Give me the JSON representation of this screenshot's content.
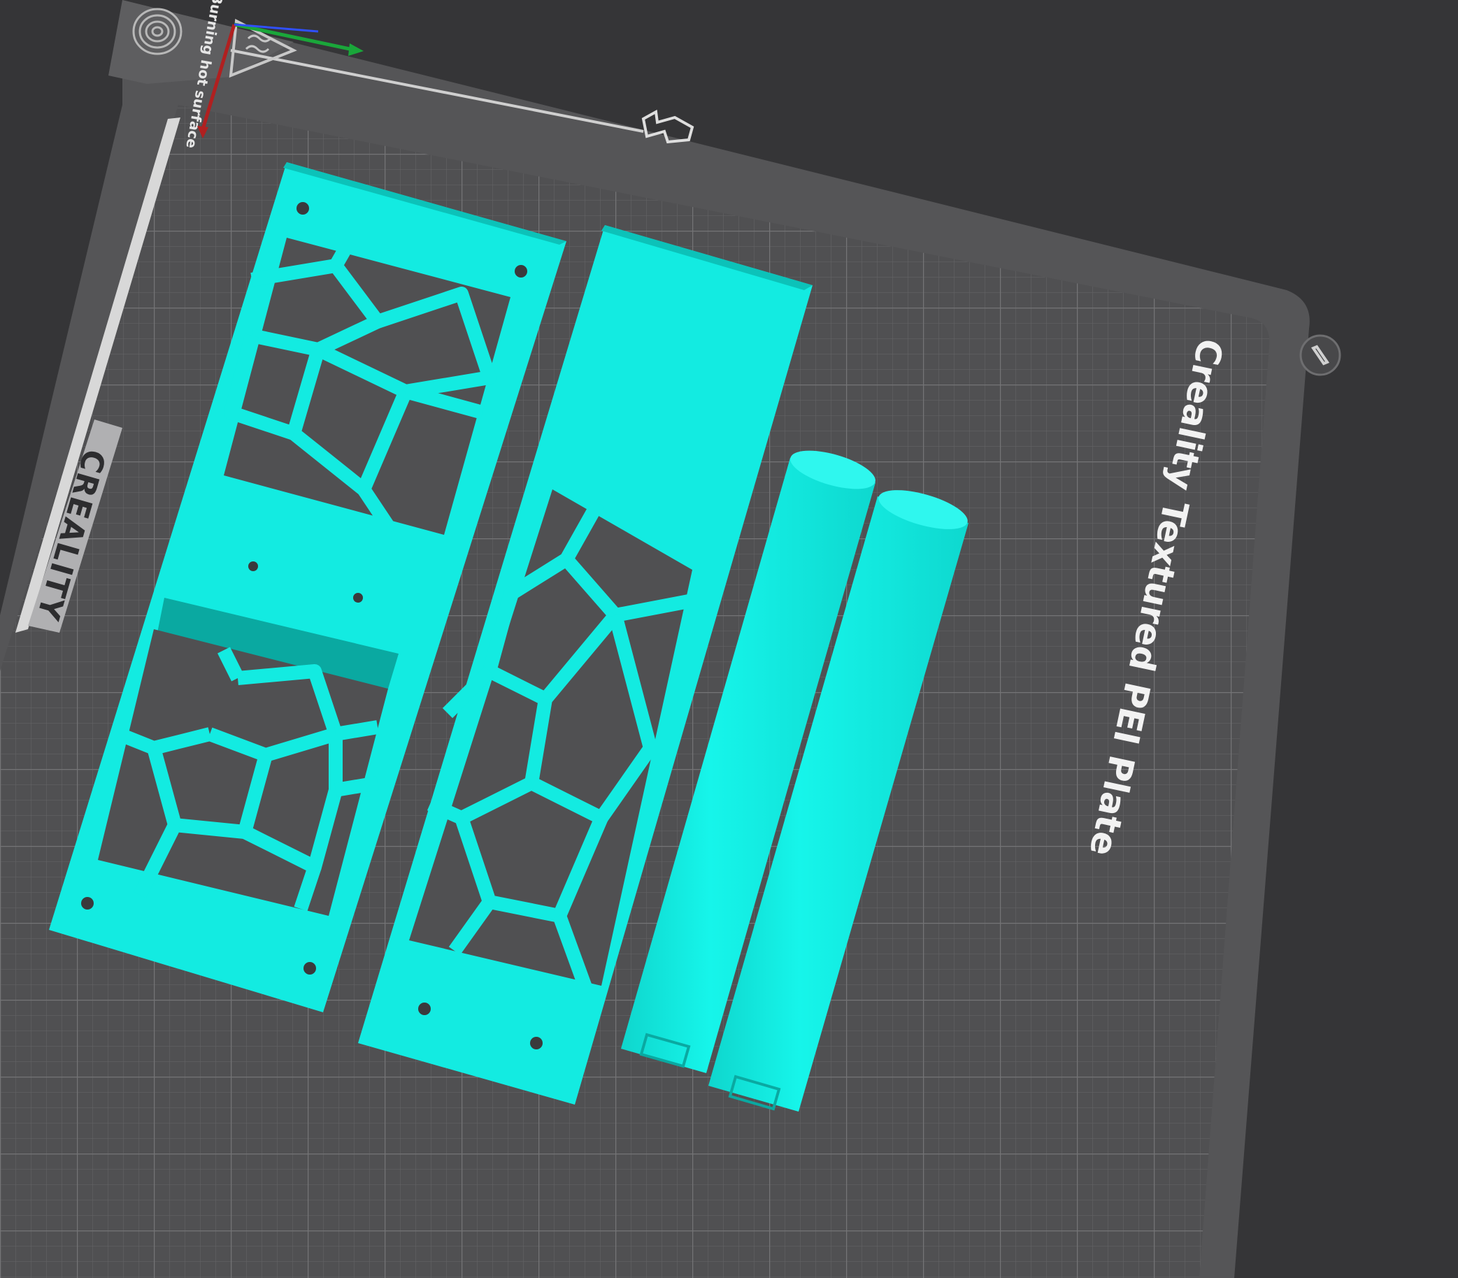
{
  "scene": {
    "plate_label": "Creality Textured PEI Plate",
    "brand_label": "CREALITY",
    "warning_label": "Burning hot surface",
    "model_color": "#14f0e6",
    "model_dark": "#0bb5ad",
    "plate_color": "#565658",
    "background_color": "#353537"
  },
  "axes": {
    "x_axis_color": "#1aa63a",
    "y_axis_color": "#b02020",
    "z_axis_color": "#3050ff"
  },
  "icons": {
    "fingerprint": "fingerprint-icon",
    "hot_surface": "hot-surface-warning-icon",
    "home_arrow": "home-arrow-icon",
    "edit": "edit-pencil-icon"
  },
  "models": [
    {
      "id": "voronoi-panel-left",
      "type": "voronoi-panel"
    },
    {
      "id": "voronoi-panel-center",
      "type": "voronoi-panel"
    },
    {
      "id": "cylinder-left",
      "type": "cylinder"
    },
    {
      "id": "cylinder-right",
      "type": "cylinder"
    }
  ]
}
